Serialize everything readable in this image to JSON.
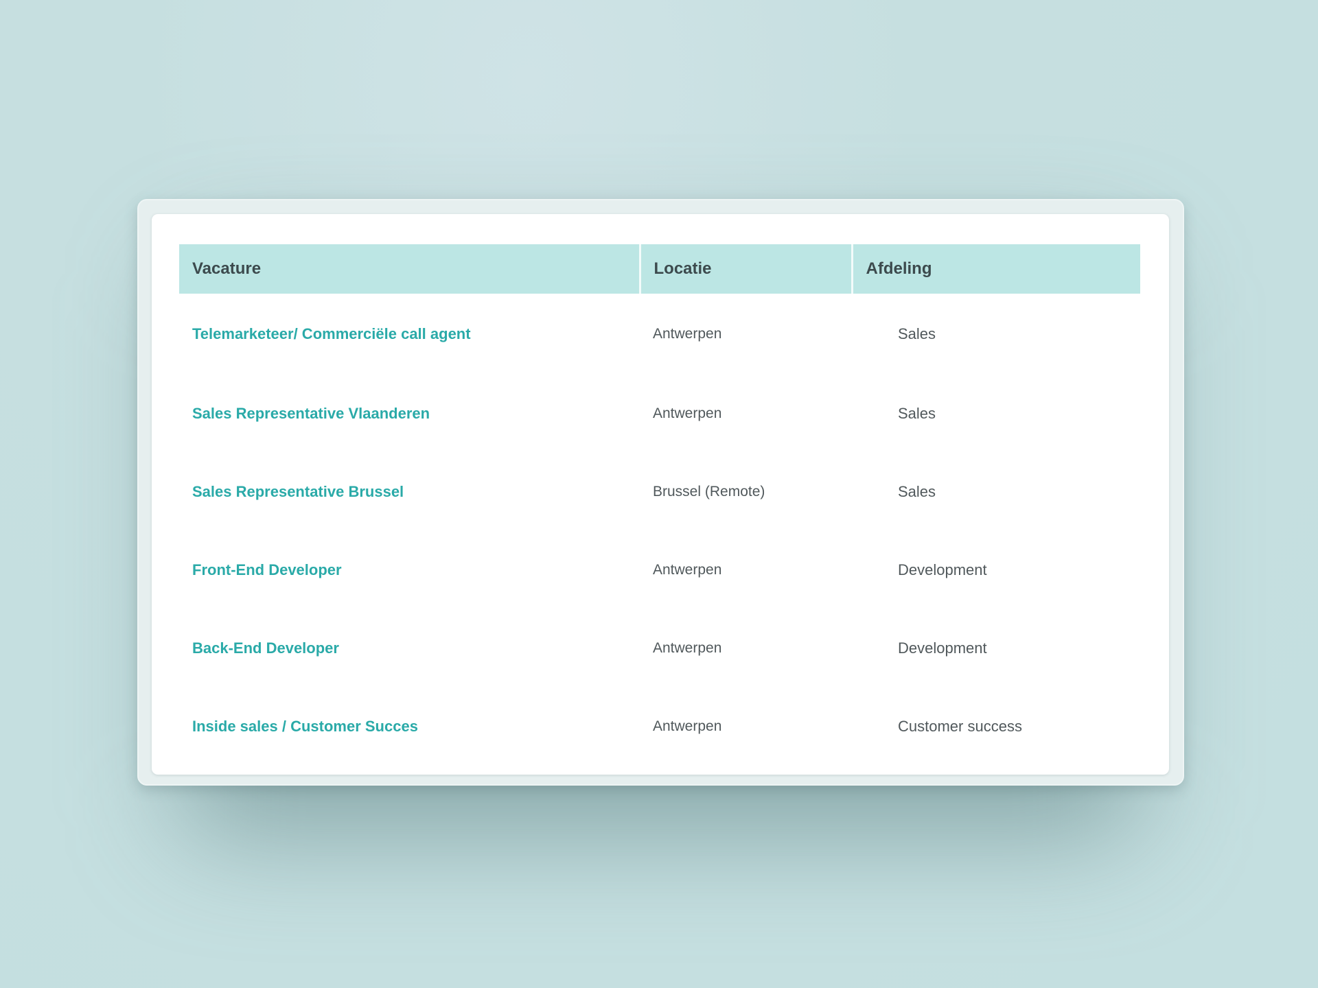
{
  "colors": {
    "background": "#c6dfe0",
    "header_background": "#bce6e4",
    "link_text": "#2aaaa8",
    "body_text": "#50585b",
    "header_text": "#3c4a4d"
  },
  "table": {
    "headers": {
      "vacature": "Vacature",
      "locatie": "Locatie",
      "afdeling": "Afdeling"
    },
    "rows": [
      {
        "title": "Telemarketeer/ Commerciële call agent",
        "location": "Antwerpen",
        "department": "Sales"
      },
      {
        "title": "Sales Representative Vlaanderen",
        "location": "Antwerpen",
        "department": "Sales"
      },
      {
        "title": "Sales Representative Brussel",
        "location": "Brussel (Remote)",
        "department": "Sales"
      },
      {
        "title": "Front-End Developer",
        "location": "Antwerpen",
        "department": "Development"
      },
      {
        "title": "Back-End Developer",
        "location": "Antwerpen",
        "department": "Development"
      },
      {
        "title": "Inside sales / Customer Succes",
        "location": "Antwerpen",
        "department": "Customer success"
      }
    ]
  }
}
